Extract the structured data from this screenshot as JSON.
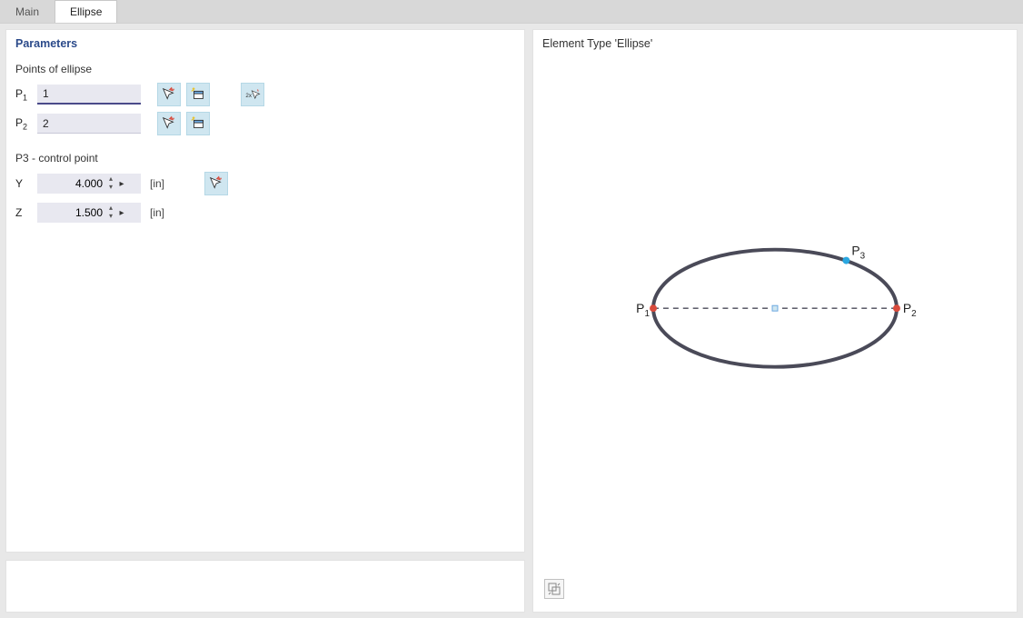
{
  "tabs": {
    "main": "Main",
    "ellipse": "Ellipse",
    "active": "Ellipse"
  },
  "params": {
    "title": "Parameters",
    "points_heading": "Points of ellipse",
    "p1_label": "P",
    "p1_sub": "1",
    "p1_value": "1",
    "p2_label": "P",
    "p2_sub": "2",
    "p2_value": "2",
    "control_heading": "P3 - control point",
    "y_label": "Y",
    "y_value": "4.000",
    "y_unit": "[in]",
    "z_label": "Z",
    "z_value": "1.500",
    "z_unit": "[in]"
  },
  "icons": {
    "pick": "pick-cursor-icon",
    "new_window": "new-window-icon",
    "twox_pick": "2x-pick-icon",
    "twox_label": "2x",
    "transform": "transform-icon"
  },
  "preview": {
    "title": "Element Type 'Ellipse'",
    "p1_label": "P",
    "p1_sub": "1",
    "p2_label": "P",
    "p2_sub": "2",
    "p3_label": "P",
    "p3_sub": "3"
  },
  "chart_data": {
    "type": "diagram",
    "element": "ellipse",
    "major_axis_points": [
      "P1",
      "P2"
    ],
    "control_point": "P3",
    "control_coordinates": {
      "Y_in": 4.0,
      "Z_in": 1.5
    },
    "axis_style": "dashed",
    "p1_color": "#d94b3d",
    "p2_color": "#d94b3d",
    "p3_color": "#2aa7e0",
    "outline_color": "#4a4a58"
  }
}
